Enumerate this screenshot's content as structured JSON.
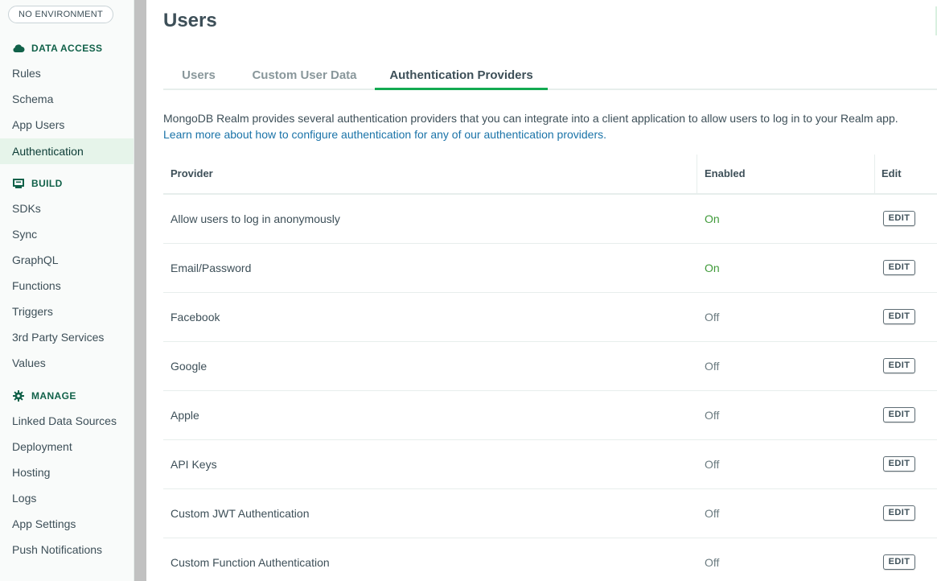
{
  "sidebar": {
    "environment_badge": "NO ENVIRONMENT",
    "sections": {
      "data_access": {
        "label": "DATA ACCESS",
        "icon": "cloud-icon",
        "items": [
          "Rules",
          "Schema",
          "App Users",
          "Authentication"
        ]
      },
      "build": {
        "label": "BUILD",
        "icon": "monitor-icon",
        "items": [
          "SDKs",
          "Sync",
          "GraphQL",
          "Functions",
          "Triggers",
          "3rd Party Services",
          "Values"
        ]
      },
      "manage": {
        "label": "MANAGE",
        "icon": "gear-icon",
        "items": [
          "Linked Data Sources",
          "Deployment",
          "Hosting",
          "Logs",
          "App Settings",
          "Push Notifications"
        ]
      }
    },
    "active_item": "Authentication"
  },
  "main": {
    "title": "Users",
    "tabs": [
      {
        "label": "Users"
      },
      {
        "label": "Custom User Data"
      },
      {
        "label": "Authentication Providers"
      }
    ],
    "active_tab": "Authentication Providers",
    "description": "MongoDB Realm provides several authentication providers that you can integrate into a client application to allow users to log in to your Realm app.",
    "learn_more_link": "Learn more about how to configure authentication for any of our authentication providers.",
    "table": {
      "headers": {
        "provider": "Provider",
        "enabled": "Enabled",
        "edit": "Edit"
      },
      "rows": [
        {
          "provider": "Allow users to log in anonymously",
          "enabled": "On",
          "edit": "EDIT"
        },
        {
          "provider": "Email/Password",
          "enabled": "On",
          "edit": "EDIT"
        },
        {
          "provider": "Facebook",
          "enabled": "Off",
          "edit": "EDIT"
        },
        {
          "provider": "Google",
          "enabled": "Off",
          "edit": "EDIT"
        },
        {
          "provider": "Apple",
          "enabled": "Off",
          "edit": "EDIT"
        },
        {
          "provider": "API Keys",
          "enabled": "Off",
          "edit": "EDIT"
        },
        {
          "provider": "Custom JWT Authentication",
          "enabled": "Off",
          "edit": "EDIT"
        },
        {
          "provider": "Custom Function Authentication",
          "enabled": "Off",
          "edit": "EDIT"
        }
      ]
    }
  },
  "colors": {
    "accent_green": "#13aa52",
    "section_header": "#116149",
    "status_on": "#3f9a39",
    "link": "#1a73a8",
    "active_nav_bg": "#e6f4ea"
  }
}
